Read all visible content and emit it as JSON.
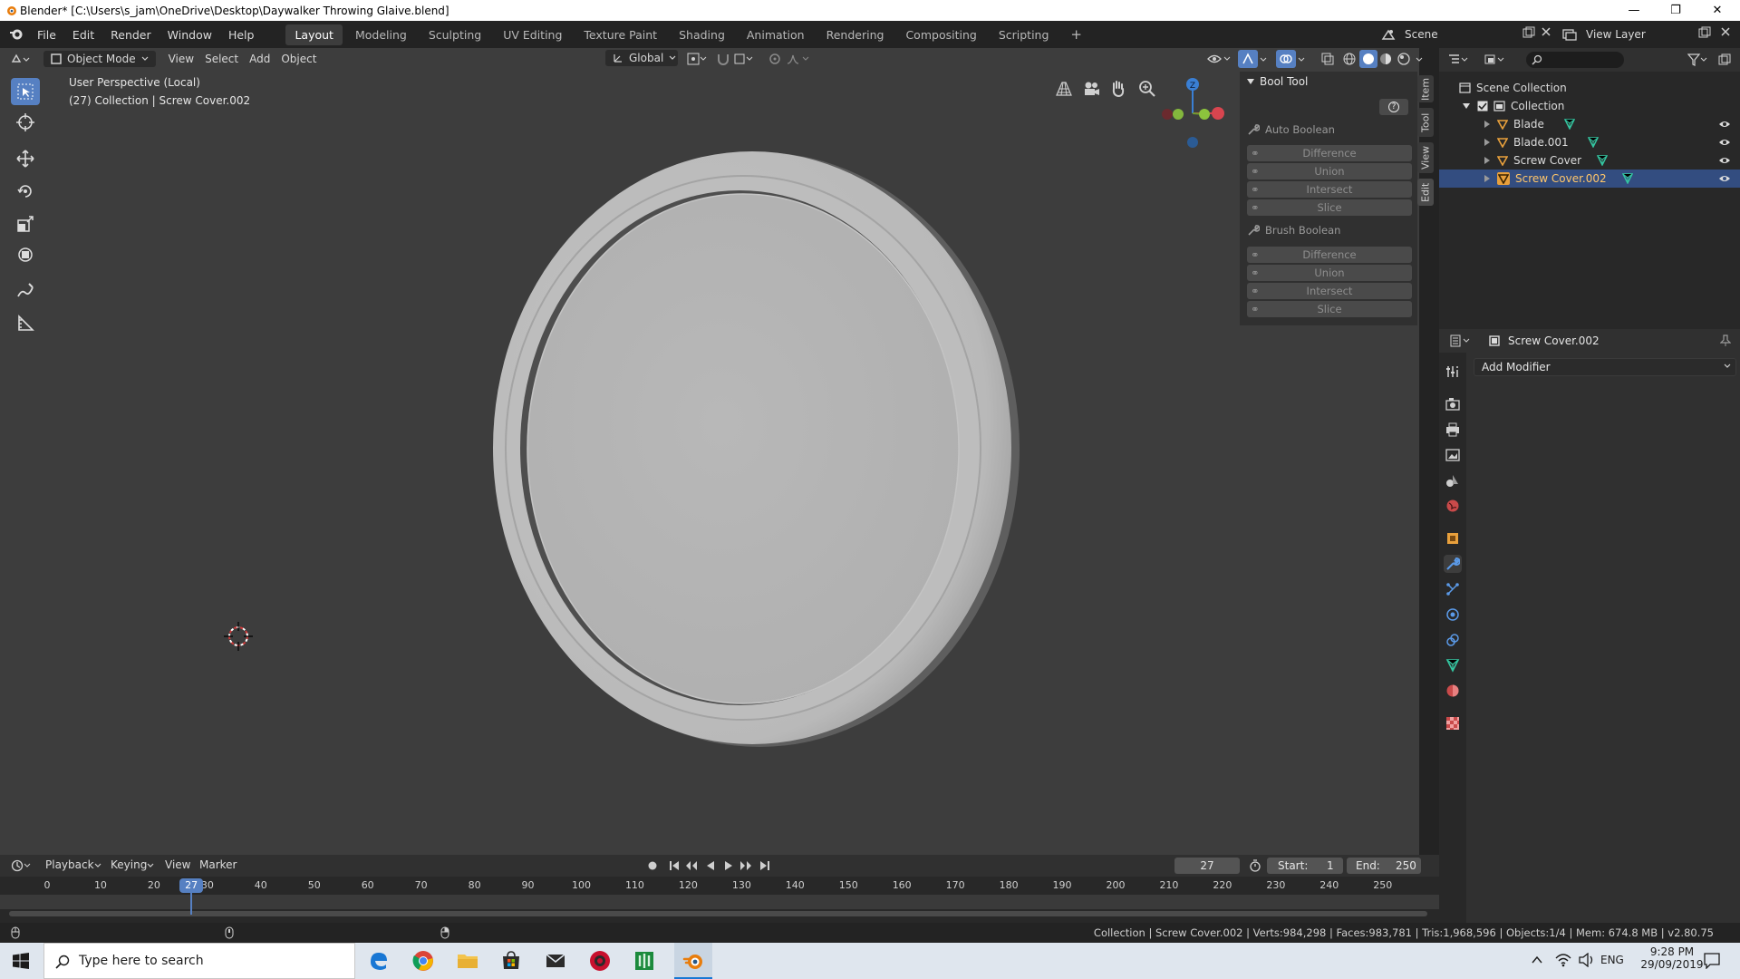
{
  "window": {
    "title": "Blender* [C:\\Users\\s_jam\\OneDrive\\Desktop\\Daywalker Throwing Glaive.blend]",
    "controls": [
      "—",
      "❐",
      "✕"
    ]
  },
  "menu": [
    "File",
    "Edit",
    "Render",
    "Window",
    "Help"
  ],
  "workspaces": [
    "Layout",
    "Modeling",
    "Sculpting",
    "UV Editing",
    "Texture Paint",
    "Shading",
    "Animation",
    "Rendering",
    "Compositing",
    "Scripting"
  ],
  "active_workspace": "Layout",
  "add_workspace": "+",
  "scene": {
    "label": "Scene",
    "view_layer": "View Layer"
  },
  "viewport_header": {
    "mode": "Object Mode",
    "menus": [
      "View",
      "Select",
      "Add",
      "Object"
    ],
    "transform_orientation": "Global"
  },
  "viewport_info": {
    "perspective": "User Perspective (Local)",
    "context": "(27) Collection | Screw Cover.002"
  },
  "gizmo": {
    "z": "Z"
  },
  "bool_tool": {
    "title": "Bool Tool",
    "help": "?",
    "auto_boolean": "Auto Boolean",
    "auto_buttons": [
      "Difference",
      "Union",
      "Intersect",
      "Slice"
    ],
    "brush_boolean": "Brush Boolean",
    "brush_buttons": [
      "Difference",
      "Union",
      "Intersect",
      "Slice"
    ]
  },
  "side_tabs": [
    "Item",
    "Tool",
    "View",
    "Edit"
  ],
  "outliner": {
    "root": "Scene Collection",
    "collection": "Collection",
    "objects": [
      {
        "name": "Blade",
        "selected": false
      },
      {
        "name": "Blade.001",
        "selected": false
      },
      {
        "name": "Screw Cover",
        "selected": false
      },
      {
        "name": "Screw Cover.002",
        "selected": true
      }
    ]
  },
  "properties": {
    "object_name": "Screw Cover.002",
    "add_modifier": "Add Modifier"
  },
  "timeline": {
    "menus": [
      "Playback",
      "Keying",
      "View",
      "Marker"
    ],
    "current_frame": "27",
    "start_label": "Start:",
    "start": "1",
    "end_label": "End:",
    "end": "250",
    "ticks": [
      "0",
      "10",
      "20",
      "30",
      "40",
      "50",
      "60",
      "70",
      "80",
      "90",
      "100",
      "110",
      "120",
      "130",
      "140",
      "150",
      "160",
      "170",
      "180",
      "190",
      "200",
      "210",
      "220",
      "230",
      "240",
      "250"
    ],
    "playhead": "27"
  },
  "status": "Collection | Screw Cover.002 | Verts:984,298 | Faces:983,781 | Tris:1,968,596 | Objects:1/4 | Mem: 674.8 MB | v2.80.75",
  "taskbar": {
    "search_placeholder": "Type here to search",
    "language": "ENG",
    "time": "9:28 PM",
    "date": "29/09/2019"
  },
  "colors": {
    "accent": "#5680c2",
    "viewport_bg": "#3d3d3d",
    "selected_row": "#334d80",
    "object_orange": "#e8a03c",
    "mesh_green": "#34c6a1"
  }
}
